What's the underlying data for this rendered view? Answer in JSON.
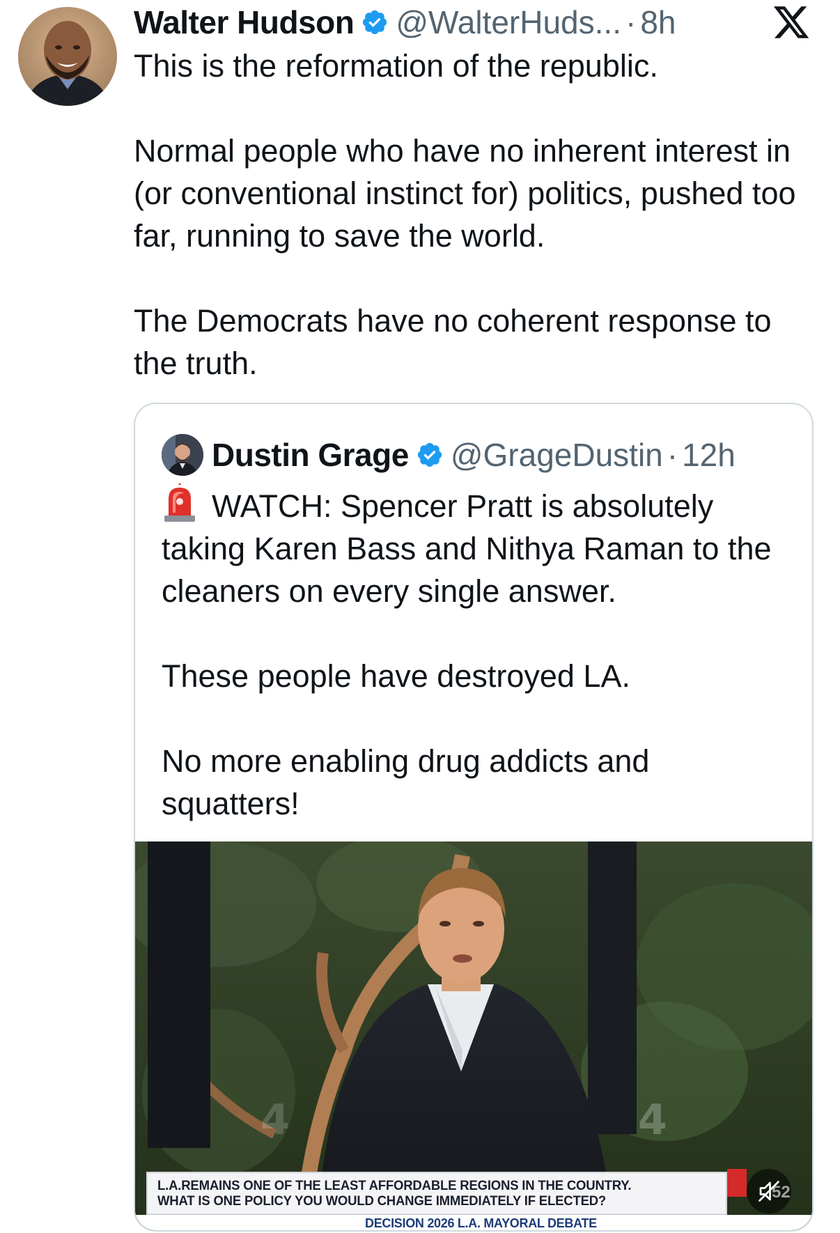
{
  "tweet": {
    "author_name": "Walter Hudson",
    "handle": "@WalterHuds...",
    "separator": "·",
    "time": "8h",
    "verified_icon": "verified-badge-icon",
    "avatar": "author-avatar",
    "paragraphs": [
      "This is the reformation of the republic.",
      "Normal people who have no inherent interest in (or conventional instinct for) politics, pushed too far, running to save the world.",
      "The Democrats have no coherent response to the truth."
    ]
  },
  "platform_logo": "x-logo-icon",
  "quoted_tweet": {
    "author_name": "Dustin Grage",
    "handle": "@GrageDustin",
    "separator": "·",
    "time": "12h",
    "verified_icon": "verified-badge-icon",
    "siren_icon": "police-siren-emoji",
    "paragraphs": [
      "WATCH: Spencer Pratt is absolutely taking Karen Bass and Nithya Raman to the cleaners on every single answer.",
      "These people have destroyed LA.",
      "No more enabling drug addicts and squatters!"
    ],
    "video": {
      "lower_third_line1": "L.A.REMAINS ONE OF THE LEAST AFFORDABLE REGIONS IN THE COUNTRY.",
      "lower_third_line2": "WHAT IS ONE POLICY YOU WOULD CHANGE IMMEDIATELY IF ELECTED?",
      "ticker": "DECISION 2026 L.A. MAYORAL DEBATE",
      "mute_icon": "speaker-muted-icon",
      "channel_logo_text": "52"
    }
  },
  "colors": {
    "verified_blue": "#1d9bf0",
    "text_primary": "#0f1419",
    "text_secondary": "#536471",
    "card_border": "#cfd9de"
  }
}
